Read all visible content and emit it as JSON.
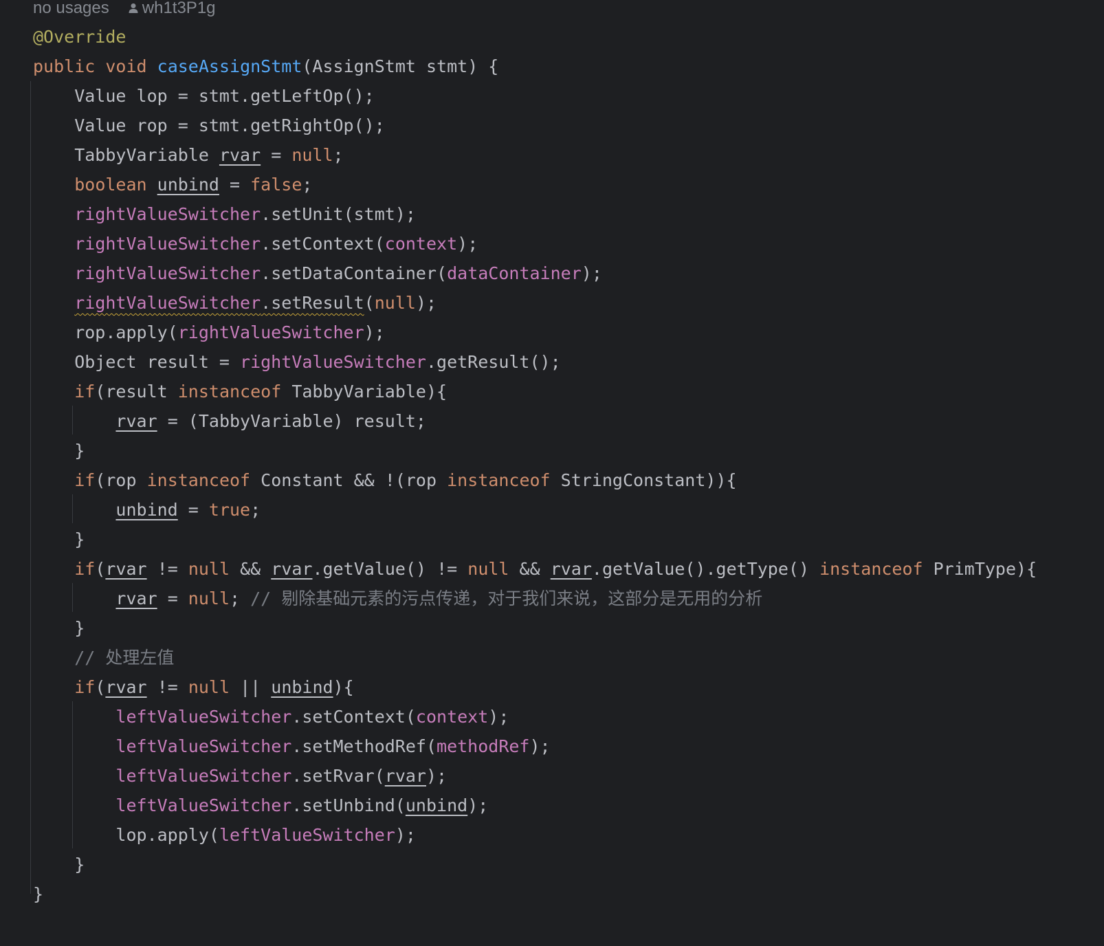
{
  "inlay_hint": {
    "usages": "no usages",
    "author": "wh1t3P1g"
  },
  "colors": {
    "background": "#1e1f22",
    "default_text": "#bcbec4",
    "keyword": "#cf8e6d",
    "annotation": "#b3ae60",
    "method_declaration": "#56a8f5",
    "field": "#c77dbb",
    "comment": "#7a7e85",
    "warning_underline": "#c9a53a"
  },
  "lines": [
    [
      {
        "t": "@Override",
        "c": "ann"
      }
    ],
    [
      {
        "t": "public",
        "c": "kw"
      },
      {
        "t": " "
      },
      {
        "t": "void",
        "c": "kw"
      },
      {
        "t": " "
      },
      {
        "t": "caseAssignStmt",
        "c": "fn"
      },
      {
        "t": "(AssignStmt stmt) {"
      }
    ],
    [
      {
        "t": "    Value lop = stmt.getLeftOp();"
      }
    ],
    [
      {
        "t": "    Value rop = stmt.getRightOp();"
      }
    ],
    [
      {
        "t": "    TabbyVariable "
      },
      {
        "t": "rvar",
        "c": "ul"
      },
      {
        "t": " = "
      },
      {
        "t": "null",
        "c": "kw"
      },
      {
        "t": ";"
      }
    ],
    [
      {
        "t": "    "
      },
      {
        "t": "boolean",
        "c": "kw"
      },
      {
        "t": " "
      },
      {
        "t": "unbind",
        "c": "ul"
      },
      {
        "t": " = "
      },
      {
        "t": "false",
        "c": "kw"
      },
      {
        "t": ";"
      }
    ],
    [
      {
        "t": "    "
      },
      {
        "t": "rightValueSwitcher",
        "c": "fld"
      },
      {
        "t": ".setUnit(stmt);"
      }
    ],
    [
      {
        "t": "    "
      },
      {
        "t": "rightValueSwitcher",
        "c": "fld"
      },
      {
        "t": ".setContext("
      },
      {
        "t": "context",
        "c": "fld"
      },
      {
        "t": ");"
      }
    ],
    [
      {
        "t": "    "
      },
      {
        "t": "rightValueSwitcher",
        "c": "fld"
      },
      {
        "t": ".setDataContainer("
      },
      {
        "t": "dataContainer",
        "c": "fld"
      },
      {
        "t": ");"
      }
    ],
    [
      {
        "t": "    "
      },
      {
        "t": "rightValueSwitcher",
        "c": "fld warn"
      },
      {
        "t": ".setResult",
        "c": "warn"
      },
      {
        "t": "("
      },
      {
        "t": "null",
        "c": "kw"
      },
      {
        "t": ");"
      }
    ],
    [
      {
        "t": "    rop.apply("
      },
      {
        "t": "rightValueSwitcher",
        "c": "fld"
      },
      {
        "t": ");"
      }
    ],
    [
      {
        "t": "    Object result = "
      },
      {
        "t": "rightValueSwitcher",
        "c": "fld"
      },
      {
        "t": ".getResult();"
      }
    ],
    [
      {
        "t": "    "
      },
      {
        "t": "if",
        "c": "kw"
      },
      {
        "t": "(result "
      },
      {
        "t": "instanceof",
        "c": "kw"
      },
      {
        "t": " TabbyVariable){"
      }
    ],
    [
      {
        "t": "        "
      },
      {
        "t": "rvar",
        "c": "ul"
      },
      {
        "t": " = (TabbyVariable) result;"
      }
    ],
    [
      {
        "t": "    }"
      }
    ],
    [
      {
        "t": "    "
      },
      {
        "t": "if",
        "c": "kw"
      },
      {
        "t": "(rop "
      },
      {
        "t": "instanceof",
        "c": "kw"
      },
      {
        "t": " Constant && !(rop "
      },
      {
        "t": "instanceof",
        "c": "kw"
      },
      {
        "t": " StringConstant)){"
      }
    ],
    [
      {
        "t": "        "
      },
      {
        "t": "unbind",
        "c": "ul"
      },
      {
        "t": " = "
      },
      {
        "t": "true",
        "c": "kw"
      },
      {
        "t": ";"
      }
    ],
    [
      {
        "t": "    }"
      }
    ],
    [
      {
        "t": "    "
      },
      {
        "t": "if",
        "c": "kw"
      },
      {
        "t": "("
      },
      {
        "t": "rvar",
        "c": "ul"
      },
      {
        "t": " != "
      },
      {
        "t": "null",
        "c": "kw"
      },
      {
        "t": " && "
      },
      {
        "t": "rvar",
        "c": "ul"
      },
      {
        "t": ".getValue() != "
      },
      {
        "t": "null",
        "c": "kw"
      },
      {
        "t": " && "
      },
      {
        "t": "rvar",
        "c": "ul"
      },
      {
        "t": ".getValue().getType() "
      },
      {
        "t": "instanceof",
        "c": "kw"
      },
      {
        "t": " PrimType){"
      }
    ],
    [
      {
        "t": "        "
      },
      {
        "t": "rvar",
        "c": "ul"
      },
      {
        "t": " = "
      },
      {
        "t": "null",
        "c": "kw"
      },
      {
        "t": "; "
      },
      {
        "t": "// ",
        "c": "cmt"
      },
      {
        "t": "剔除基础元素的污点传递，对于我们来说，这部分是无用的分析",
        "c": "cmt cjk"
      }
    ],
    [
      {
        "t": "    }"
      }
    ],
    [
      {
        "t": "    "
      },
      {
        "t": "// ",
        "c": "cmt"
      },
      {
        "t": "处理左值",
        "c": "cmt cjk"
      }
    ],
    [
      {
        "t": "    "
      },
      {
        "t": "if",
        "c": "kw"
      },
      {
        "t": "("
      },
      {
        "t": "rvar",
        "c": "ul"
      },
      {
        "t": " != "
      },
      {
        "t": "null",
        "c": "kw"
      },
      {
        "t": " || "
      },
      {
        "t": "unbind",
        "c": "ul"
      },
      {
        "t": "){"
      }
    ],
    [
      {
        "t": "        "
      },
      {
        "t": "leftValueSwitcher",
        "c": "fld"
      },
      {
        "t": ".setContext("
      },
      {
        "t": "context",
        "c": "fld"
      },
      {
        "t": ");"
      }
    ],
    [
      {
        "t": "        "
      },
      {
        "t": "leftValueSwitcher",
        "c": "fld"
      },
      {
        "t": ".setMethodRef("
      },
      {
        "t": "methodRef",
        "c": "fld"
      },
      {
        "t": ");"
      }
    ],
    [
      {
        "t": "        "
      },
      {
        "t": "leftValueSwitcher",
        "c": "fld"
      },
      {
        "t": ".setRvar("
      },
      {
        "t": "rvar",
        "c": "ul"
      },
      {
        "t": ");"
      }
    ],
    [
      {
        "t": "        "
      },
      {
        "t": "leftValueSwitcher",
        "c": "fld"
      },
      {
        "t": ".setUnbind("
      },
      {
        "t": "unbind",
        "c": "ul"
      },
      {
        "t": ");"
      }
    ],
    [
      {
        "t": "        lop.apply("
      },
      {
        "t": "leftValueSwitcher",
        "c": "fld"
      },
      {
        "t": ");"
      }
    ],
    [
      {
        "t": "    }"
      }
    ],
    [
      {
        "t": "}"
      }
    ]
  ]
}
